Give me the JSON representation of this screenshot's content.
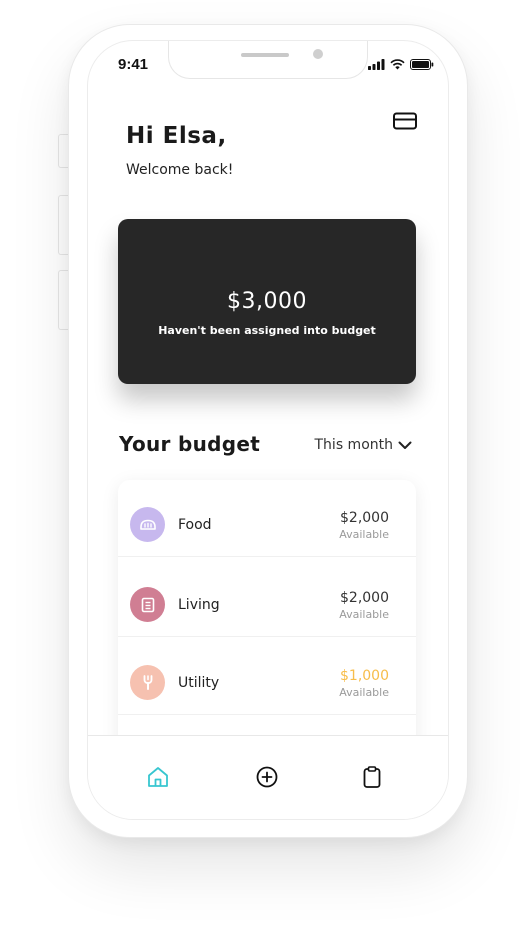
{
  "status_bar": {
    "time": "9:41"
  },
  "header": {
    "greeting": "Hi Elsa,",
    "subtitle": "Welcome back!",
    "wallet_icon": "credit-card-icon"
  },
  "balance_card": {
    "amount": "$3,000",
    "caption": "Haven't been assigned into budget"
  },
  "budget": {
    "title": "Your budget",
    "period": "This month",
    "items": [
      {
        "label": "Food",
        "amount": "$2,000",
        "status": "Available",
        "icon": "bread-icon",
        "icon_color": "#c7b8ee",
        "amount_color": "#333333"
      },
      {
        "label": "Living",
        "amount": "$2,000",
        "status": "Available",
        "icon": "document-icon",
        "icon_color": "#d07e93",
        "amount_color": "#333333"
      },
      {
        "label": "Utility",
        "amount": "$1,000",
        "status": "Available",
        "icon": "bulb-icon",
        "icon_color": "#f6c1b0",
        "amount_color": "#f7bd4a"
      }
    ]
  },
  "tab_bar": {
    "tabs": [
      {
        "name": "home",
        "icon": "home-icon",
        "active": true
      },
      {
        "name": "add",
        "icon": "plus-circle-icon",
        "active": false
      },
      {
        "name": "clipboard",
        "icon": "clipboard-icon",
        "active": false
      }
    ],
    "accent": "#37c6d0"
  }
}
